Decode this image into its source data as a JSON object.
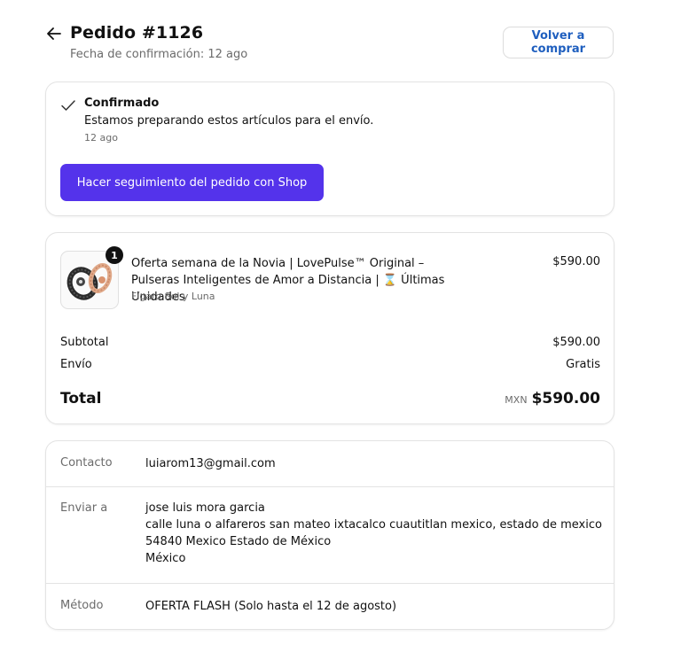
{
  "header": {
    "title": "Pedido #1126",
    "confirmation_date": "Fecha de confirmación: 12 ago",
    "buy_again_label": "Volver a comprar"
  },
  "status": {
    "title": "Confirmado",
    "message": "Estamos preparando estos artículos para el envío.",
    "time": "12 ago",
    "track_button_label": "Hacer seguimiento del pedido con Shop",
    "accent_color": "#5433eb"
  },
  "order": {
    "item": {
      "name": "Oferta semana de la Novia | LovePulse™ Original – Pulseras Inteligentes de Amor a Distancia | ⌛ Últimas Unidades",
      "variant": "Fígaro Sol y Luna",
      "price": "$590.00",
      "quantity": "1"
    },
    "subtotal_label": "Subtotal",
    "subtotal_value": "$590.00",
    "shipping_label": "Envío",
    "shipping_value": "Gratis",
    "total_label": "Total",
    "currency": "MXN",
    "total_value": "$590.00"
  },
  "info": {
    "contact_label": "Contacto",
    "contact_value": "luiarom13@gmail.com",
    "ship_to_label": "Enviar a",
    "ship_to_lines": [
      "jose luis mora garcia",
      "calle luna o alfareros san mateo ixtacalco cuautitlan mexico, estado de mexico",
      "54840 Mexico Estado de México",
      "México"
    ],
    "method_label": "Método",
    "method_value": "OFERTA FLASH (Solo hasta el 12 de agosto)"
  }
}
